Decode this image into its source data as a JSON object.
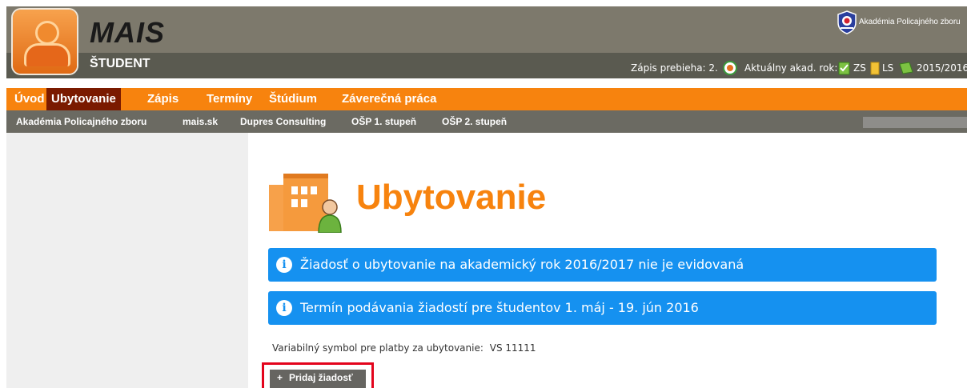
{
  "brand": {
    "app_name": "MAIS",
    "role": "ŠTUDENT",
    "academy_name": "Akadémia Policajného zboru"
  },
  "status": {
    "enrollment_label": "Zápis prebieha: 2.",
    "academic_year_label": "Aktuálny akad. rok:",
    "winter_semester": "ZS",
    "summer_semester": "LS",
    "academic_year": "2015/2016"
  },
  "main_nav": {
    "items": [
      {
        "label": "Úvod"
      },
      {
        "label": "Ubytovanie"
      },
      {
        "label": "Zápis"
      },
      {
        "label": "Termíny"
      },
      {
        "label": "Štúdium"
      },
      {
        "label": "Záverečná práca"
      }
    ],
    "active_index": 1
  },
  "sub_nav": {
    "items": [
      {
        "label": "Akadémia Policajného zboru"
      },
      {
        "label": "mais.sk"
      },
      {
        "label": "Dupres Consulting"
      },
      {
        "label": "OŠP 1. stupeň"
      },
      {
        "label": "OŠP 2. stupeň"
      }
    ]
  },
  "page": {
    "title": "Ubytovanie",
    "alerts": [
      {
        "text": "Žiadosť o ubytovanie na akademický rok 2016/2017 nie je evidovaná"
      },
      {
        "text": "Termín podávania žiadostí pre študentov 1. máj - 19. jún 2016"
      }
    ],
    "variable_symbol_label": "Variabilný symbol pre platby za ubytovanie:",
    "variable_symbol_value": "VS 11111",
    "add_button_label": "Pridaj žiadosť",
    "add_button_icon": "+"
  },
  "colors": {
    "accent_orange": "#f7830e",
    "active_nav": "#7a1a00",
    "alert_blue": "#1591f0",
    "highlight_red": "#e3041c"
  }
}
